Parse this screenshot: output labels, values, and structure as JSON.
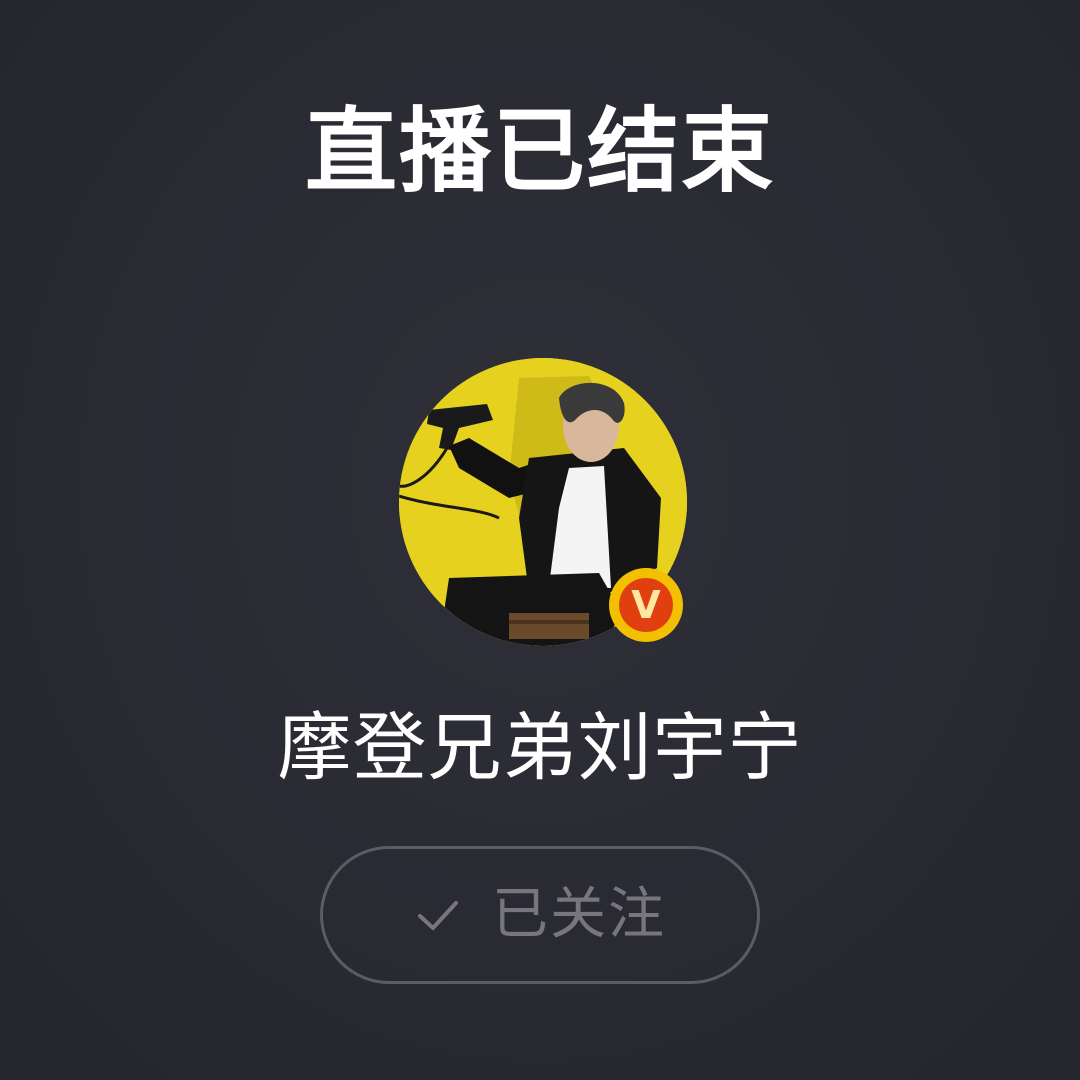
{
  "live_end": {
    "title": "直播已结束"
  },
  "streamer": {
    "name": "摩登兄弟刘宇宁",
    "avatar": "avatar-photo",
    "verified_badge": "V",
    "verified_badge_colors": {
      "ring": "#f2c000",
      "fill": "#e0400f"
    }
  },
  "follow_button": {
    "icon": "check-icon",
    "label": "已关注"
  },
  "colors": {
    "background": "#2a2a33",
    "title_text": "#ffffff",
    "button_border": "#5c5c63",
    "button_text": "#76767c",
    "avatar_background": "#e8d31c"
  }
}
